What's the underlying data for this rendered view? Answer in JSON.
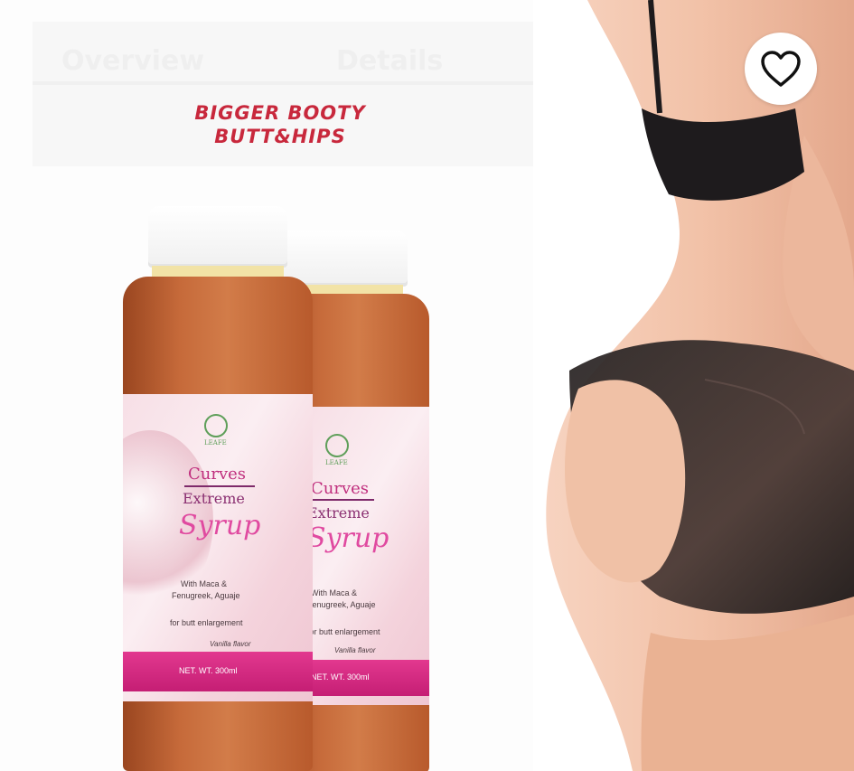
{
  "tabs": [
    {
      "label": "Overview"
    },
    {
      "label": "Details"
    }
  ],
  "headline": {
    "line1": "BIGGER BOOTY",
    "line2": "BUTT&HIPS"
  },
  "product": {
    "brand": "LEAFE",
    "name_line1": "Curves",
    "name_line2": "Extreme",
    "name_line3": "Syrup",
    "ingredients_line1": "With Maca &",
    "ingredients_line2": "Fenugreek, Aguaje",
    "purpose": "for butt enlargement",
    "flavor": "Vanilla flavor",
    "net_weight": "NET. WT. 300ml"
  },
  "favorite": {
    "icon": "heart-outline-icon"
  },
  "colors": {
    "headline": "#c8283c",
    "label_pink": "#e2388f",
    "syrup": "#c66a3a"
  }
}
